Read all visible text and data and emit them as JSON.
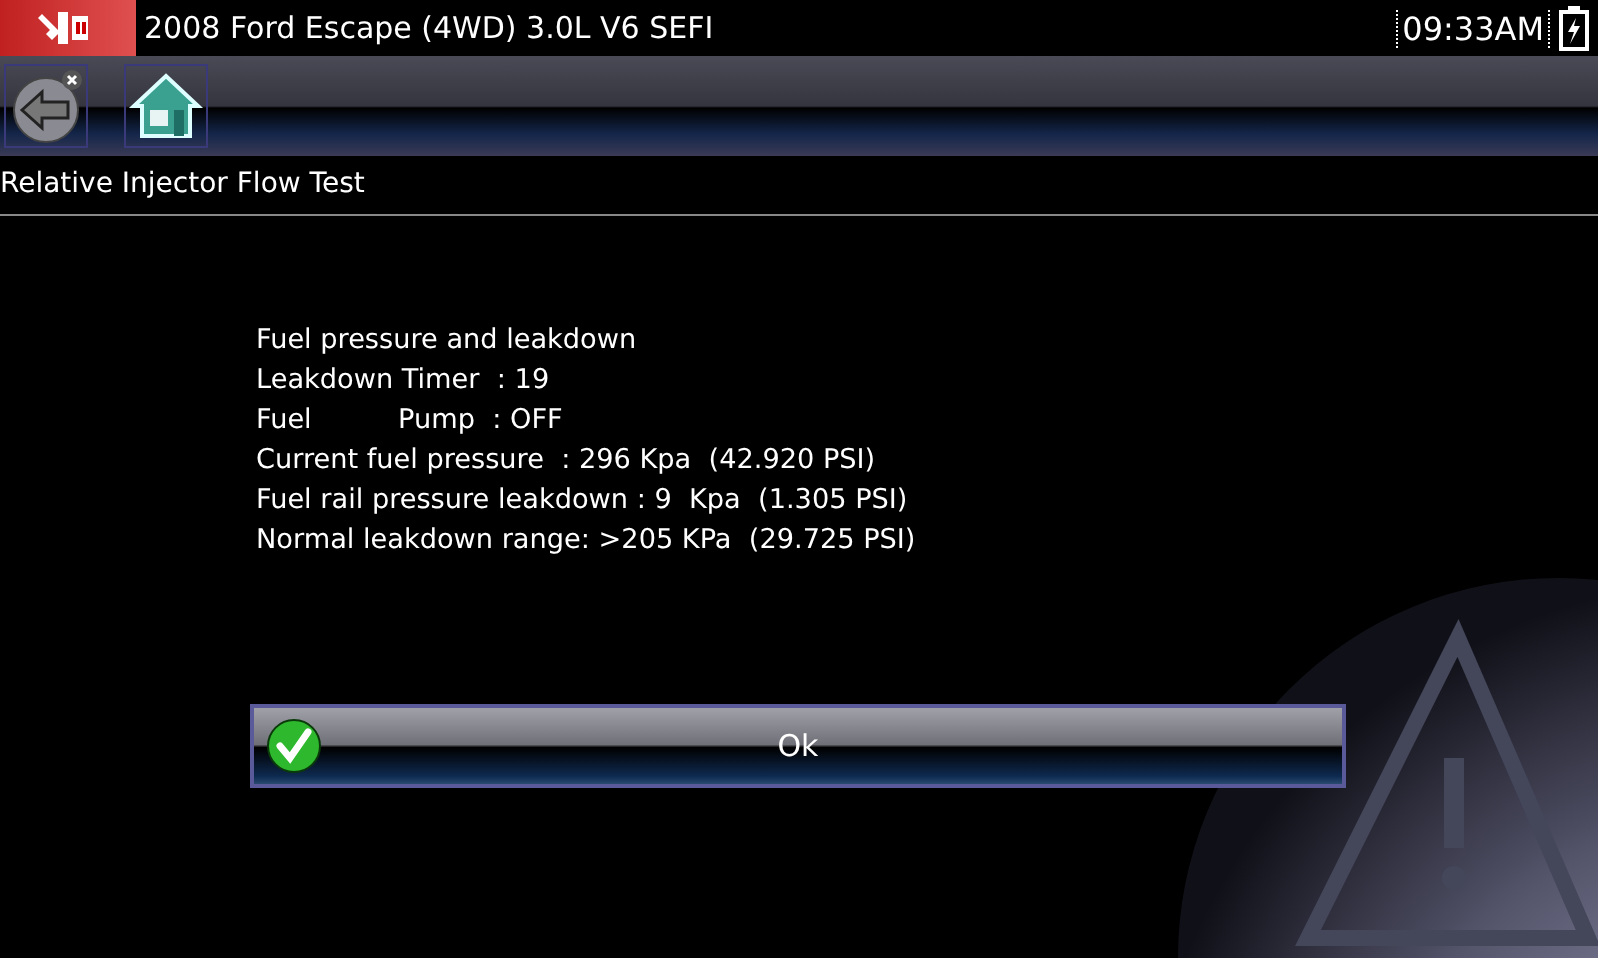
{
  "header": {
    "title": "2008 Ford Escape (4WD) 3.0L V6 SEFI",
    "time": "09:33AM"
  },
  "toolbar": [
    {
      "kind": "back"
    },
    {
      "kind": "home"
    }
  ],
  "screen_title": "Relative Injector Flow Test",
  "lines": [
    "Fuel pressure and leakdown",
    "Leakdown Timer  : 19",
    "Fuel          Pump  : OFF",
    "Current fuel pressure  : 296 Kpa  (42.920 PSI)",
    "Fuel rail pressure leakdown : 9  Kpa  (1.305 PSI)",
    "Normal leakdown range: >205 KPa  (29.725 PSI)"
  ],
  "ok_button": {
    "label": "Ok"
  }
}
